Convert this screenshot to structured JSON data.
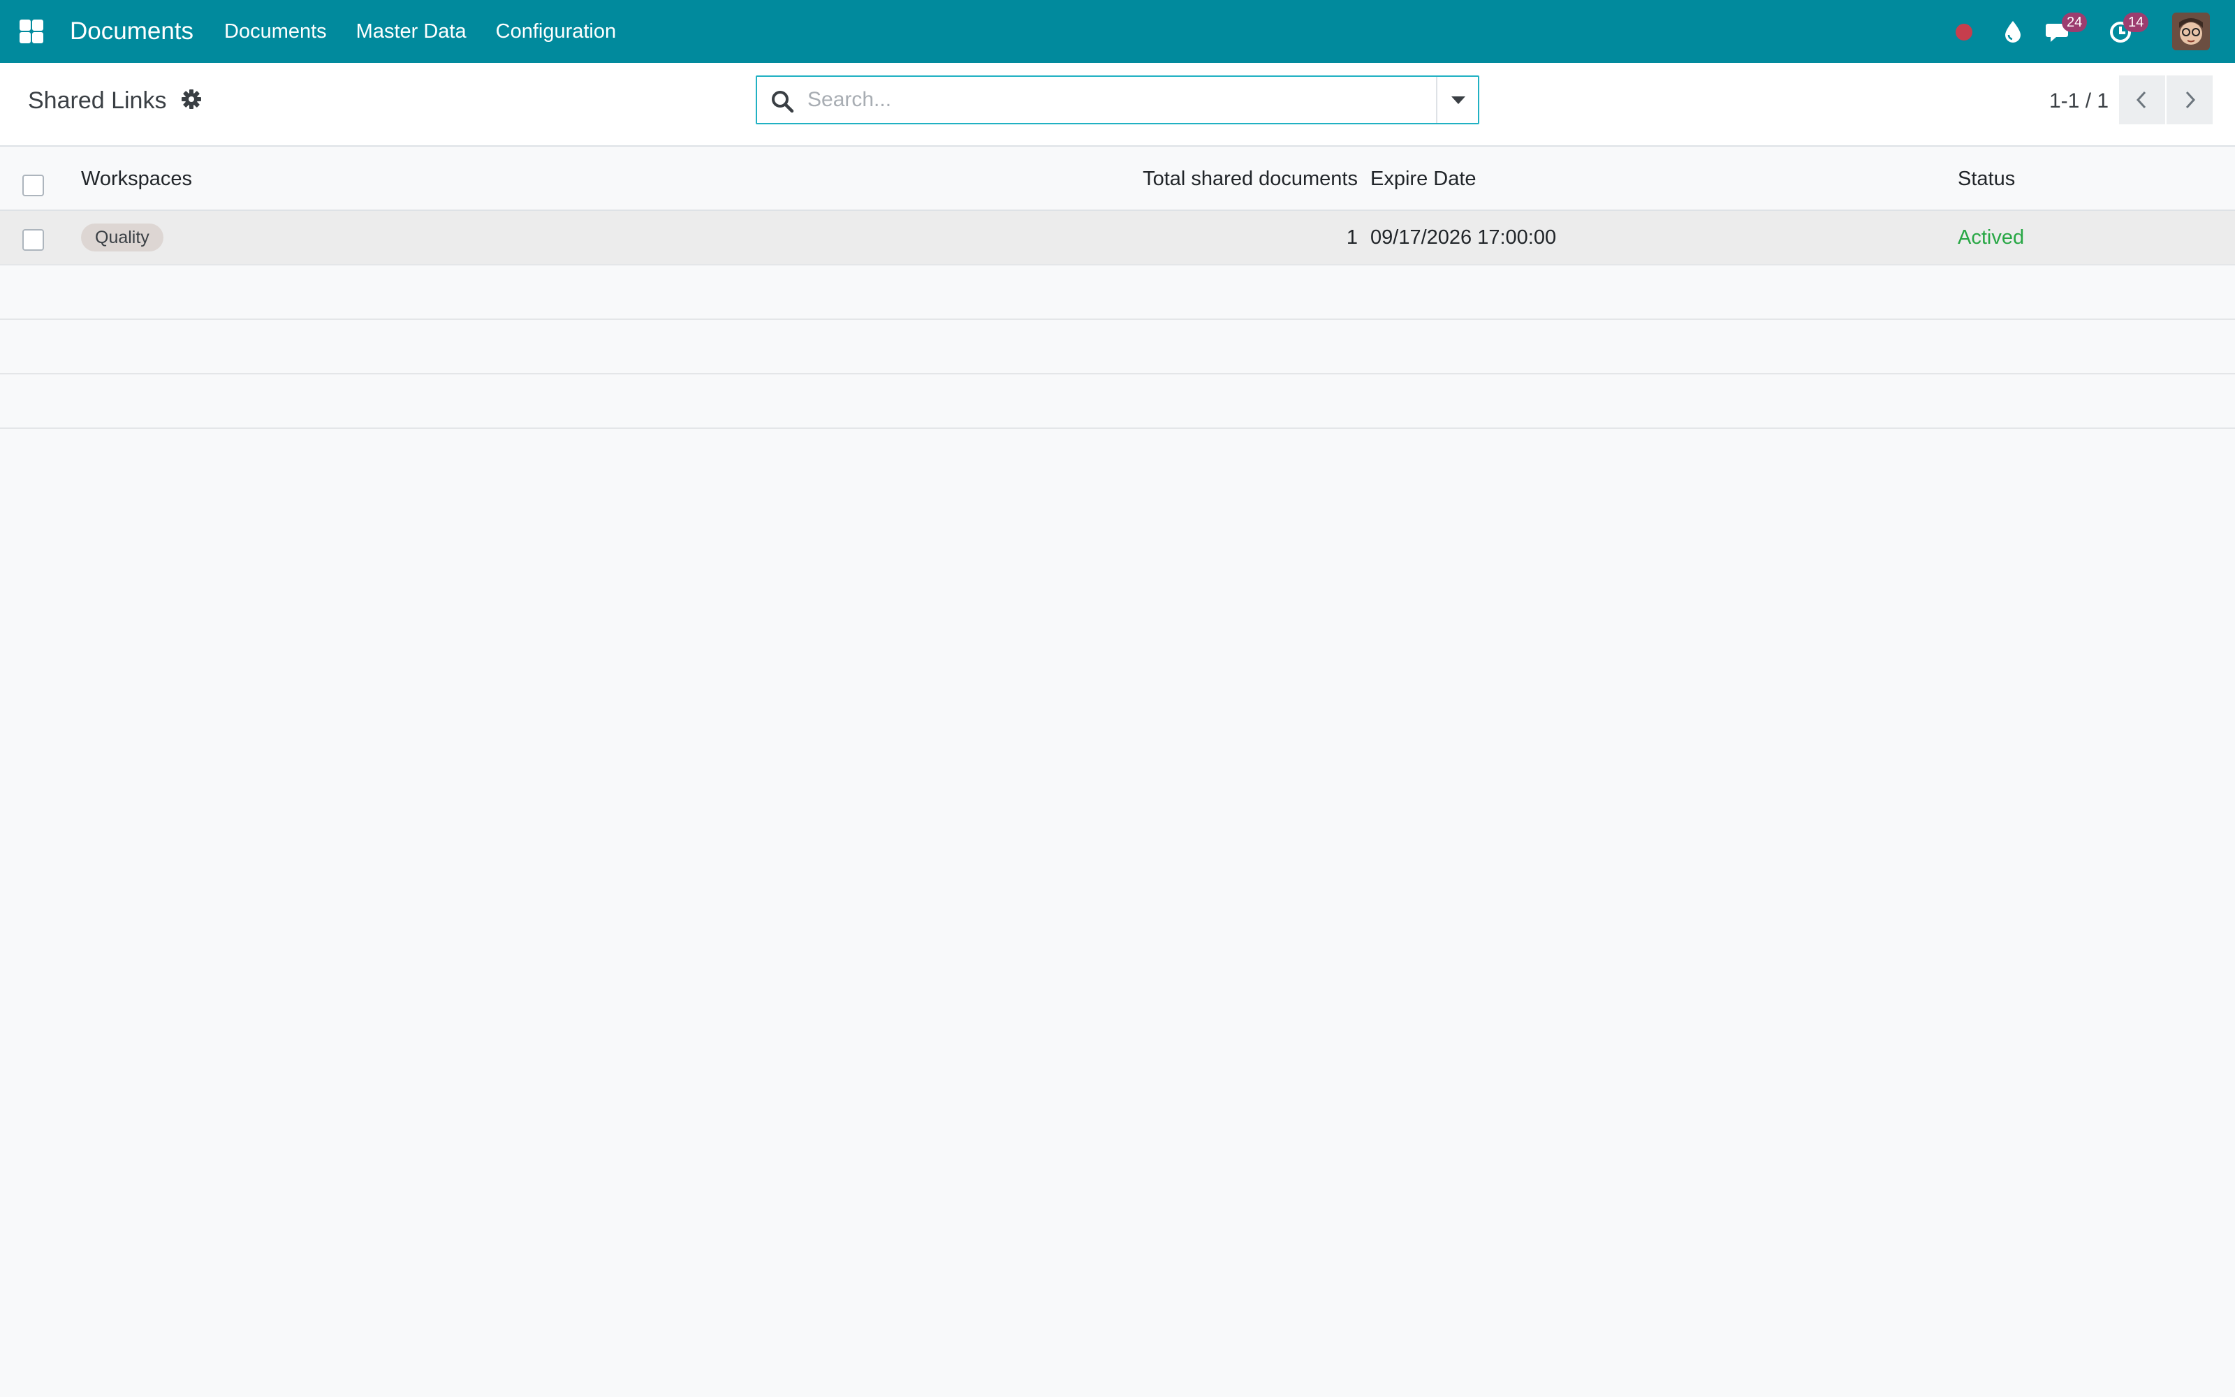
{
  "navbar": {
    "app_name": "Documents",
    "menu": [
      "Documents",
      "Master Data",
      "Configuration"
    ],
    "messages_count": "24",
    "activities_count": "14",
    "accent_color": "#018a9d"
  },
  "control_panel": {
    "title": "Shared Links",
    "search_placeholder": "Search...",
    "pager": "1-1 / 1"
  },
  "list": {
    "columns": {
      "workspaces": "Workspaces",
      "total": "Total shared documents",
      "expire": "Expire Date",
      "status": "Status"
    },
    "rows": [
      {
        "workspace": "Quality",
        "total": "1",
        "expire_date": "09/17/2026 17:00:00",
        "status": "Actived"
      }
    ]
  },
  "icons": [
    "apps-grid-icon",
    "gear-icon",
    "search-icon",
    "caret-down-icon",
    "chevron-left-icon",
    "chevron-right-icon",
    "record-dot-icon",
    "droplet-icon",
    "chat-icon",
    "clock-icon"
  ]
}
